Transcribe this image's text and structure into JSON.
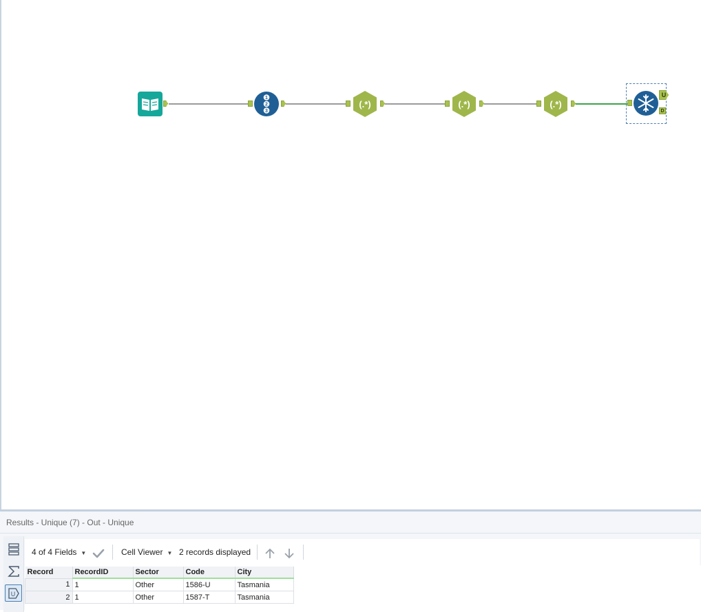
{
  "canvas": {
    "tools": [
      {
        "id": "input",
        "icon": "book-input-icon"
      },
      {
        "id": "recordid",
        "icon": "record-id-icon",
        "glyphs": [
          "1",
          "2",
          "3"
        ]
      },
      {
        "id": "regex1",
        "icon": "regex-icon",
        "label": "(.*)"
      },
      {
        "id": "regex2",
        "icon": "regex-icon",
        "label": "(.*)"
      },
      {
        "id": "regex3",
        "icon": "regex-icon",
        "label": "(.*)"
      },
      {
        "id": "unique",
        "icon": "unique-snowflake-icon",
        "outputs": [
          "U",
          "D"
        ]
      }
    ]
  },
  "results": {
    "title": "Results - Unique (7) - Out - Unique",
    "toolbar": {
      "fields_label": "4 of 4 Fields",
      "viewer_label": "Cell Viewer",
      "records_label": "2 records displayed"
    },
    "table": {
      "columns": [
        "Record",
        "RecordID",
        "Sector",
        "Code",
        "City"
      ],
      "rows": [
        {
          "record": "1",
          "RecordID": "1",
          "Sector": "Other",
          "Code": "1586-U",
          "City": "Tasmania"
        },
        {
          "record": "2",
          "RecordID": "1",
          "Sector": "Other",
          "Code": "1587-T",
          "City": "Tasmania"
        }
      ]
    }
  },
  "colors": {
    "accent_blue": "#1f5f96",
    "regex_green": "#9fb64b",
    "input_teal": "#15a79a",
    "connection_green": "#3aa34a"
  }
}
